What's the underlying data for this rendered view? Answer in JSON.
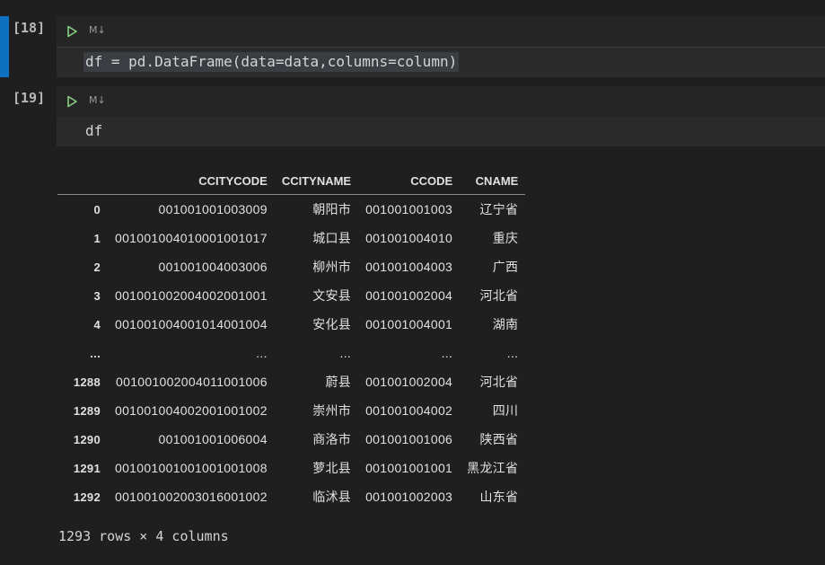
{
  "cells": [
    {
      "exec_count": "[18]",
      "cell_type_label": "M↓",
      "code": "df = pd.DataFrame(data=data,columns=column)"
    },
    {
      "exec_count": "[19]",
      "cell_type_label": "M↓",
      "code": "df"
    }
  ],
  "dataframe": {
    "columns": [
      "",
      "CCITYCODE",
      "CCITYNAME",
      "CCODE",
      "CNAME"
    ],
    "rows": [
      [
        "0",
        "001001001003009",
        "朝阳市",
        "001001001003",
        "辽宁省"
      ],
      [
        "1",
        "001001004010001001017",
        "城口县",
        "001001004010",
        "重庆"
      ],
      [
        "2",
        "001001004003006",
        "柳州市",
        "001001004003",
        "广西"
      ],
      [
        "3",
        "001001002004002001001",
        "文安县",
        "001001002004",
        "河北省"
      ],
      [
        "4",
        "001001004001014001004",
        "安化县",
        "001001004001",
        "湖南"
      ],
      [
        "...",
        "...",
        "...",
        "...",
        "..."
      ],
      [
        "1288",
        "001001002004011001006",
        "蔚县",
        "001001002004",
        "河北省"
      ],
      [
        "1289",
        "001001004002001001002",
        "崇州市",
        "001001004002",
        "四川"
      ],
      [
        "1290",
        "001001001006004",
        "商洛市",
        "001001001006",
        "陕西省"
      ],
      [
        "1291",
        "001001001001001001008",
        "萝北县",
        "001001001001",
        "黑龙江省"
      ],
      [
        "1292",
        "001001002003016001002",
        "临沭县",
        "001001002003",
        "山东省"
      ]
    ],
    "summary": "1293 rows × 4 columns"
  },
  "colors": {
    "background": "#1f1f1f",
    "active_cell_bar": "#0e70c0",
    "run_icon": "#89d185"
  },
  "icons": {
    "run": "run-triangle-icon"
  }
}
